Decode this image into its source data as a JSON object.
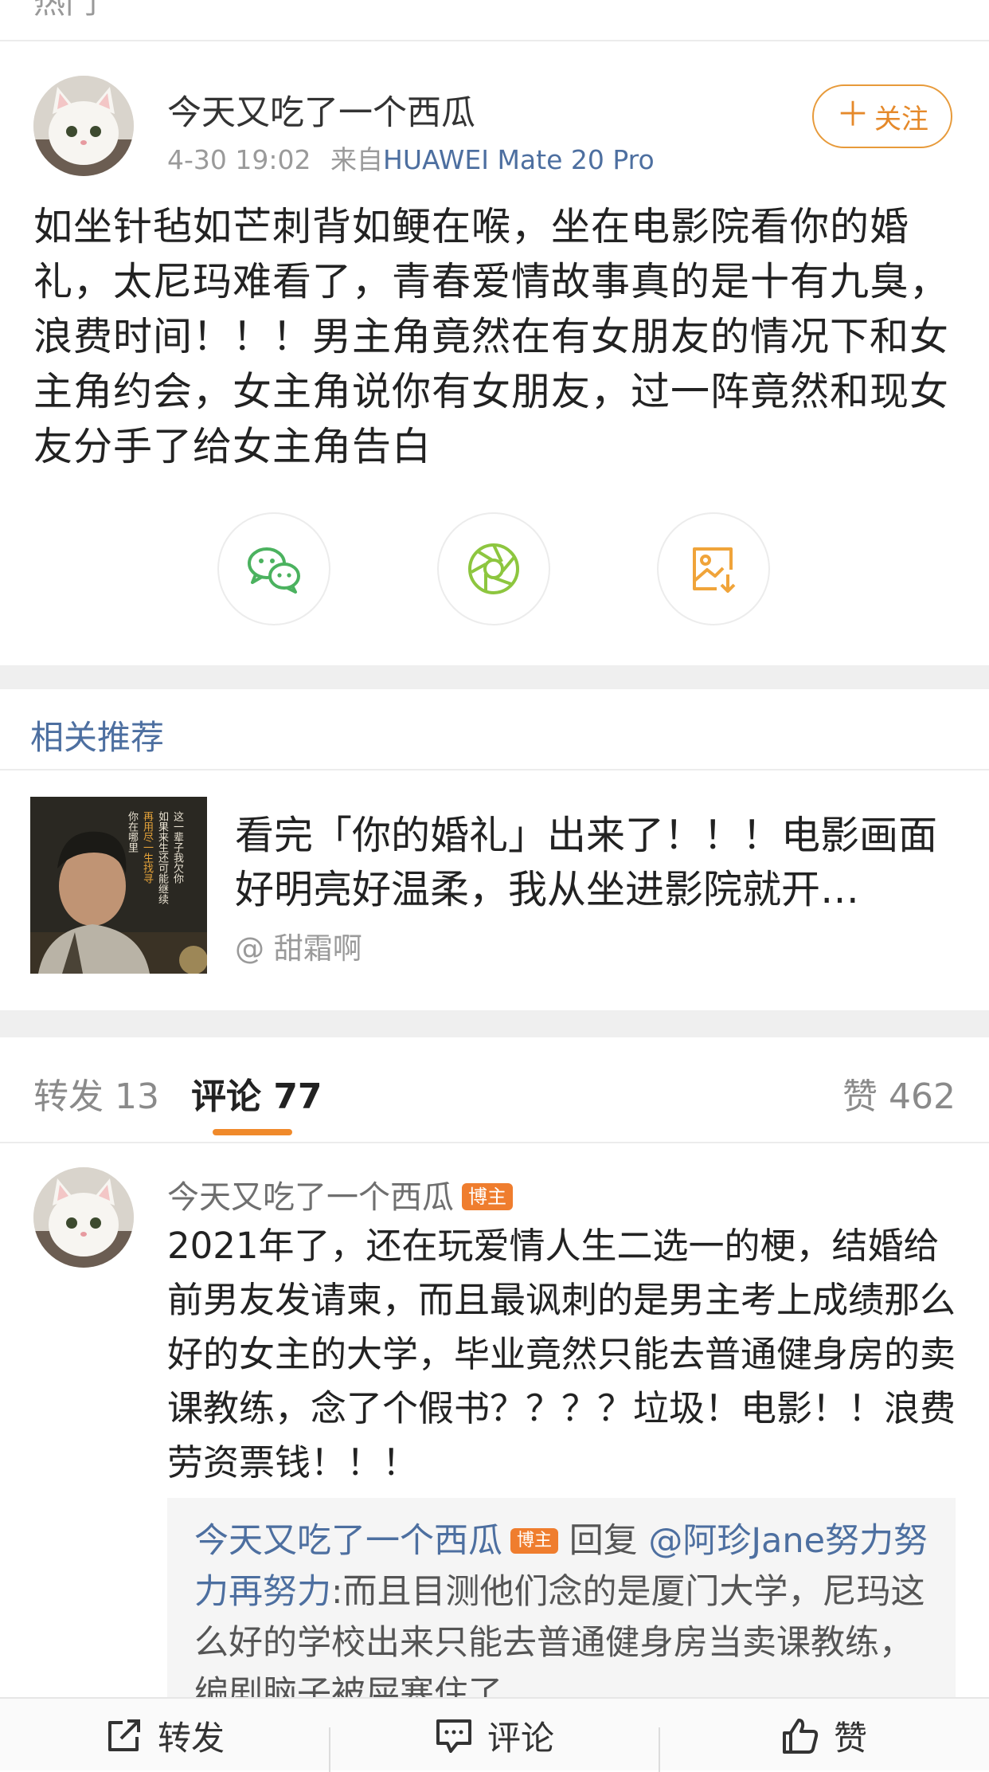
{
  "header": {
    "cut_title": "热门"
  },
  "post": {
    "author": "今天又吃了一个西瓜",
    "time": "4-30 19:02",
    "source_prefix": "来自",
    "device": "HUAWEI Mate 20 Pro",
    "follow_label": "关注",
    "follow_plus": "＋",
    "text": "如坐针毡如芒刺背如鲠在喉，坐在电影院看你的婚礼，太尼玛难看了，青春爱情故事真的是十有九臭，浪费时间！！！男主角竟然在有女朋友的情况下和女主角约会，女主角说你有女朋友，过一阵竟然和现女友分手了给女主角告白"
  },
  "share": {
    "icons": [
      "wechat-icon",
      "moments-icon",
      "save-image-icon"
    ],
    "colors": {
      "wechat": "#4bb25f",
      "moments": "#8dc63f",
      "save": "#f0a43a"
    }
  },
  "recommend": {
    "section_title": "相关推荐",
    "item": {
      "title": "看完「你的婚礼」出来了！！！电影画面好明亮好温柔，我从坐进影院就开…",
      "author": "@ 甜霜啊",
      "poster_text": [
        "这一辈子我欠你",
        "如果来生还可能继续",
        "再用尽一生找寻",
        "你在哪里"
      ]
    }
  },
  "tabs": {
    "repost": "转发 13",
    "comment": "评论 77",
    "like": "赞 462"
  },
  "comment": {
    "author": "今天又吃了一个西瓜",
    "badge": "博主",
    "text": "2021年了，还在玩爱情人生二选一的梗，结婚给前男友发请柬，而且最讽刺的是男主考上成绩那么好的女主的大学，毕业竟然只能去普通健身房的卖课教练，念了个假书？？？？垃圾！电影！！浪费劳资票钱！！！",
    "reply": {
      "author": "今天又吃了一个西瓜",
      "badge": "博主",
      "reply_word": "回复",
      "target": "@阿珍Jane努力努力再努力",
      "text": ":而且目测他们念的是厦门大学，尼玛这么好的学校出来只能去普通健身房当卖课教练，编剧脑子被屎塞住了"
    }
  },
  "toolbar": {
    "repost": "转发",
    "comment": "评论",
    "like": "赞"
  },
  "colors": {
    "accent_orange": "#f08a2b",
    "link_blue": "#4d6fa0"
  }
}
